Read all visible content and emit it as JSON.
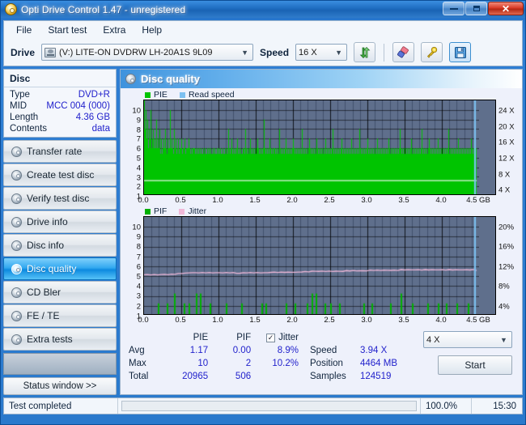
{
  "window": {
    "title": "Opti Drive Control 1.47 - unregistered",
    "app_icon": "disc-icon",
    "minimize": "minimize-icon",
    "maximize": "maximize-icon",
    "close": "✕"
  },
  "menu": {
    "items": [
      "File",
      "Start test",
      "Extra",
      "Help"
    ]
  },
  "toolbar": {
    "drive_label": "Drive",
    "drive_value": "(V:)   LITE-ON DVDRW LH-20A1S 9L09",
    "speed_label": "Speed",
    "speed_value": "16 X",
    "refresh_icon": "refresh-icon",
    "eraser_icon": "eraser-icon",
    "key_icon": "key-icon",
    "save_icon": "save-icon"
  },
  "disc_panel": {
    "title": "Disc",
    "rows": [
      {
        "key": "Type",
        "value": "DVD+R"
      },
      {
        "key": "MID",
        "value": "MCC 004 (000)"
      },
      {
        "key": "Length",
        "value": "4.36 GB"
      },
      {
        "key": "Contents",
        "value": "data"
      }
    ]
  },
  "sidebar": {
    "items": [
      {
        "label": "Transfer rate",
        "selected": false
      },
      {
        "label": "Create test disc",
        "selected": false
      },
      {
        "label": "Verify test disc",
        "selected": false
      },
      {
        "label": "Drive info",
        "selected": false
      },
      {
        "label": "Disc info",
        "selected": false
      },
      {
        "label": "Disc quality",
        "selected": true
      },
      {
        "label": "CD Bler",
        "selected": false
      },
      {
        "label": "FE / TE",
        "selected": false
      },
      {
        "label": "Extra tests",
        "selected": false
      }
    ],
    "status_window_button": "Status window >>"
  },
  "main": {
    "header": "Disc quality",
    "header_icon": "disc-quality-icon"
  },
  "stats": {
    "col_headers": [
      "PIE",
      "PIF",
      "Jitter"
    ],
    "jitter_checked": true,
    "jitter_check_glyph": "✓",
    "rows": [
      {
        "label": "Avg",
        "pie": "1.17",
        "pif": "0.00",
        "jitter": "8.9%"
      },
      {
        "label": "Max",
        "pie": "10",
        "pif": "2",
        "jitter": "10.2%"
      },
      {
        "label": "Total",
        "pie": "20965",
        "pif": "506",
        "jitter": ""
      }
    ],
    "right": [
      {
        "key": "Speed",
        "value": "3.94 X"
      },
      {
        "key": "Position",
        "value": "4464 MB"
      },
      {
        "key": "Samples",
        "value": "124519"
      }
    ],
    "speed_select": "4 X",
    "start_button": "Start"
  },
  "statusbar": {
    "text": "Test completed",
    "percent": "100.0%",
    "progress": 100,
    "time": "15:30"
  },
  "colors": {
    "pie_green": "#00c400",
    "pif_green": "#00b000",
    "read_speed_blue": "#7cc0f0",
    "jitter_pink": "#f0b8d8",
    "plot_bg": "#5f6f8c",
    "accent_blue": "#1e6cc0",
    "value_blue": "#2222cc"
  },
  "chart_data": [
    {
      "type": "area",
      "title": "PIE / Read speed",
      "xlabel": "GB",
      "ylabel": "PIE",
      "y2label": "Speed",
      "xlim": [
        0.0,
        4.5
      ],
      "xticks": [
        "0.0",
        "0.5",
        "1.0",
        "1.5",
        "2.0",
        "2.5",
        "3.0",
        "3.5",
        "4.0",
        "4.5 GB"
      ],
      "ylim": [
        0,
        10
      ],
      "yticks": [
        "10",
        "9",
        "8",
        "7",
        "6",
        "5",
        "4",
        "3",
        "2",
        "1"
      ],
      "y2lim": [
        0,
        24
      ],
      "y2ticks": [
        "24 X",
        "20 X",
        "16 X",
        "12 X",
        "8 X",
        "4 X"
      ],
      "grid": true,
      "legend": [
        {
          "name": "PIE",
          "color": "#00c400"
        },
        {
          "name": "Read speed",
          "color": "#7cc0f0"
        }
      ],
      "series": [
        {
          "name": "PIE",
          "color": "#00c400",
          "baseline": 4.4,
          "values": [
            10,
            7,
            6,
            9,
            5,
            6,
            8,
            5,
            4,
            7,
            6,
            5,
            9,
            4,
            5,
            6,
            4,
            7,
            5,
            4,
            6,
            5,
            8,
            4,
            5,
            4,
            6,
            5,
            4,
            7,
            4,
            5,
            6,
            4,
            5,
            4,
            6,
            4,
            5,
            7,
            4,
            5,
            4,
            6,
            4,
            5,
            4,
            5,
            9,
            4,
            5,
            6,
            4,
            5,
            4,
            7,
            4,
            5,
            4,
            6,
            4,
            5,
            4,
            5,
            6,
            4,
            5,
            4,
            5,
            4,
            6,
            4,
            5,
            4,
            5,
            4,
            6,
            4,
            5,
            4,
            5,
            4,
            5,
            6,
            4,
            5,
            4,
            5,
            4,
            4,
            5,
            4,
            5,
            4,
            5,
            4,
            4,
            5,
            4,
            4,
            5,
            4,
            4,
            5,
            4,
            4,
            5,
            4,
            4,
            4,
            5,
            4,
            4,
            5,
            4,
            4,
            4,
            5,
            4,
            4,
            5,
            4,
            4,
            4,
            5,
            4,
            4,
            4,
            5,
            4,
            4,
            5,
            4,
            4,
            4,
            5,
            4,
            4,
            4,
            5,
            4,
            4,
            5,
            4,
            4,
            4,
            5,
            4,
            4,
            4,
            5,
            4,
            4,
            5,
            4,
            4,
            7,
            4,
            5,
            4,
            4,
            5,
            4,
            6,
            4,
            4,
            5,
            4,
            4,
            5,
            4,
            4,
            5,
            6,
            4,
            4,
            5,
            4,
            4,
            5,
            4,
            4,
            4,
            5,
            4,
            4,
            5,
            4,
            7,
            4,
            5,
            4,
            4,
            5,
            4,
            4,
            5,
            4,
            6,
            4,
            5,
            4,
            4,
            5,
            4,
            4,
            5,
            4,
            4,
            5,
            4,
            6,
            4,
            5,
            4,
            4,
            5,
            4,
            4,
            5,
            4,
            4,
            5,
            8,
            4,
            5,
            4,
            4,
            5,
            4,
            4,
            5,
            4,
            4,
            6,
            5,
            4,
            4,
            5,
            4,
            4,
            5,
            4,
            5,
            4,
            4,
            5,
            4,
            4,
            5,
            4,
            4,
            7,
            5,
            4,
            4,
            5,
            4,
            4,
            5,
            4,
            4,
            5,
            6,
            4,
            4,
            5,
            4,
            4,
            5,
            4,
            4,
            5,
            4,
            4,
            5,
            4,
            6,
            4,
            5,
            4,
            4,
            5,
            4,
            5,
            4,
            4,
            5,
            4,
            4,
            5,
            4,
            4,
            5,
            7,
            4,
            5,
            4,
            4,
            5,
            4,
            4,
            5,
            4,
            4,
            5,
            4,
            6,
            4,
            5,
            4,
            4,
            5,
            4,
            4,
            5,
            4,
            4,
            5,
            4,
            4,
            6,
            5,
            4,
            4,
            5,
            4,
            4,
            5,
            4,
            4,
            5,
            4,
            4,
            5,
            4,
            4,
            5,
            6,
            4,
            4,
            5,
            4,
            4,
            5,
            4,
            4,
            5,
            4,
            4,
            5,
            7,
            4,
            4,
            5,
            4,
            4,
            5,
            4,
            4,
            5,
            4,
            4,
            5,
            4,
            4,
            5,
            4,
            6,
            4,
            5,
            4,
            4,
            5,
            4,
            4,
            5,
            4,
            4,
            5,
            4,
            4,
            5,
            4,
            4,
            6,
            5,
            4,
            4,
            5,
            4,
            4,
            5,
            4,
            4,
            5,
            4,
            4,
            5,
            4,
            7,
            4,
            5,
            4,
            4,
            5,
            4,
            4,
            5,
            4,
            4,
            5,
            4,
            4,
            5,
            6,
            4,
            4,
            5,
            4,
            4,
            5,
            4,
            4,
            5,
            4,
            4,
            5,
            4,
            4,
            5,
            4,
            4,
            6,
            5,
            4,
            4,
            5,
            4,
            4,
            5,
            4,
            4,
            5,
            4,
            4,
            5,
            4,
            4,
            5,
            4,
            4,
            5,
            4,
            4,
            6,
            5,
            4,
            4,
            5,
            4,
            4,
            5,
            4,
            4,
            5,
            4,
            4,
            5,
            4,
            4,
            5,
            4,
            4,
            5,
            4,
            7,
            4,
            5,
            4,
            4,
            5,
            4,
            4,
            5,
            4,
            4,
            5,
            4,
            4,
            5,
            4,
            4,
            5,
            4,
            4,
            5,
            6,
            4,
            4,
            5,
            4,
            4,
            5,
            4,
            4,
            5,
            4,
            4,
            5,
            4,
            4,
            5,
            4,
            4,
            5,
            7,
            4,
            4,
            5,
            4,
            4,
            5,
            4,
            4,
            5,
            4,
            4,
            5,
            4,
            6,
            4,
            5,
            4,
            5,
            4,
            4,
            5,
            4,
            4,
            5,
            4,
            4,
            5,
            4,
            4,
            5,
            6,
            4,
            4,
            5,
            4,
            4,
            5,
            4,
            4,
            5,
            4,
            4,
            5,
            4,
            4,
            5,
            4,
            4,
            5,
            4,
            7,
            4,
            5,
            4,
            4,
            5,
            4,
            4,
            5,
            4,
            4,
            5,
            4,
            4,
            5,
            4,
            4,
            5,
            6,
            4,
            4,
            5,
            4,
            4,
            5,
            4,
            4,
            5,
            4,
            4,
            5,
            4,
            4,
            5,
            4,
            4,
            5,
            4,
            4,
            5,
            4,
            4,
            6,
            5,
            4,
            4,
            5,
            4,
            4,
            5,
            4,
            5
          ]
        },
        {
          "name": "Read speed",
          "color": "#7cc0f0",
          "note": "vertical marker near 4.45 GB",
          "marker_x": 4.45,
          "value": 3.94
        }
      ],
      "white_baseline_y": 1.6
    },
    {
      "type": "line",
      "title": "PIF / Jitter",
      "xlabel": "GB",
      "ylabel": "PIF",
      "y2label": "Jitter",
      "xlim": [
        0.0,
        4.5
      ],
      "xticks": [
        "0.0",
        "0.5",
        "1.0",
        "1.5",
        "2.0",
        "2.5",
        "3.0",
        "3.5",
        "4.0",
        "4.5 GB"
      ],
      "ylim": [
        0,
        10
      ],
      "yticks": [
        "10",
        "9",
        "8",
        "7",
        "6",
        "5",
        "4",
        "3",
        "2",
        "1"
      ],
      "y2lim": [
        0,
        20
      ],
      "y2ticks": [
        "20%",
        "16%",
        "12%",
        "8%",
        "4%"
      ],
      "grid": true,
      "legend": [
        {
          "name": "PIF",
          "color": "#00b000"
        },
        {
          "name": "Jitter",
          "color": "#f0b8d8"
        }
      ],
      "series": [
        {
          "name": "Jitter",
          "color": "#f0b8d8",
          "values_percent": [
            8.3,
            8.3,
            8.3,
            8.3,
            8.3,
            8.3,
            8.4,
            8.3,
            8.4,
            8.4,
            8.5,
            8.6,
            8.6,
            8.7,
            8.7,
            8.7,
            8.7,
            8.7,
            8.7,
            8.7,
            8.7,
            8.7,
            8.7,
            8.7,
            8.7,
            8.7,
            8.7,
            8.6,
            8.6,
            8.7,
            8.7,
            8.7,
            8.7,
            8.7,
            8.7,
            8.7,
            8.7,
            8.8,
            8.8,
            8.8,
            8.8,
            8.8,
            8.8,
            8.8,
            8.8,
            8.8,
            8.9,
            8.9,
            8.9,
            9.0,
            9.0,
            9.0,
            9.0,
            9.0,
            9.0,
            9.0,
            9.0,
            9.0,
            9.0,
            9.1,
            9.1,
            9.1,
            9.1,
            9.1,
            9.1,
            9.1,
            9.2,
            9.2,
            9.2,
            9.2,
            9.2,
            9.2,
            9.2,
            9.2,
            9.2,
            9.3,
            9.3,
            9.3,
            9.3,
            9.3,
            9.3,
            9.3,
            9.3,
            9.3,
            9.3,
            9.3,
            9.3,
            9.3,
            9.3,
            9.3,
            9.3,
            9.3,
            9.3,
            9.3,
            9.3,
            9.3,
            9.3,
            9.2
          ]
        },
        {
          "name": "PIF",
          "color": "#00b000",
          "spikes": [
            {
              "x": 0.18,
              "y": 1
            },
            {
              "x": 0.3,
              "y": 1
            },
            {
              "x": 0.4,
              "y": 2
            },
            {
              "x": 0.53,
              "y": 1
            },
            {
              "x": 0.6,
              "y": 1
            },
            {
              "x": 0.7,
              "y": 2
            },
            {
              "x": 0.75,
              "y": 2
            },
            {
              "x": 0.88,
              "y": 1
            },
            {
              "x": 1.1,
              "y": 1
            },
            {
              "x": 1.3,
              "y": 1
            },
            {
              "x": 1.58,
              "y": 1
            },
            {
              "x": 1.63,
              "y": 1
            },
            {
              "x": 1.9,
              "y": 1
            },
            {
              "x": 2.02,
              "y": 1
            },
            {
              "x": 2.18,
              "y": 1
            },
            {
              "x": 2.25,
              "y": 2
            },
            {
              "x": 2.3,
              "y": 2
            },
            {
              "x": 2.42,
              "y": 1
            },
            {
              "x": 2.5,
              "y": 1
            },
            {
              "x": 2.62,
              "y": 1
            },
            {
              "x": 2.95,
              "y": 1
            },
            {
              "x": 3.05,
              "y": 1
            },
            {
              "x": 3.3,
              "y": 1
            },
            {
              "x": 3.45,
              "y": 2
            },
            {
              "x": 3.6,
              "y": 1
            },
            {
              "x": 3.8,
              "y": 1
            },
            {
              "x": 3.95,
              "y": 1
            },
            {
              "x": 4.05,
              "y": 1
            },
            {
              "x": 4.2,
              "y": 1
            },
            {
              "x": 4.35,
              "y": 1
            }
          ],
          "marker_x": 4.45
        }
      ]
    }
  ]
}
